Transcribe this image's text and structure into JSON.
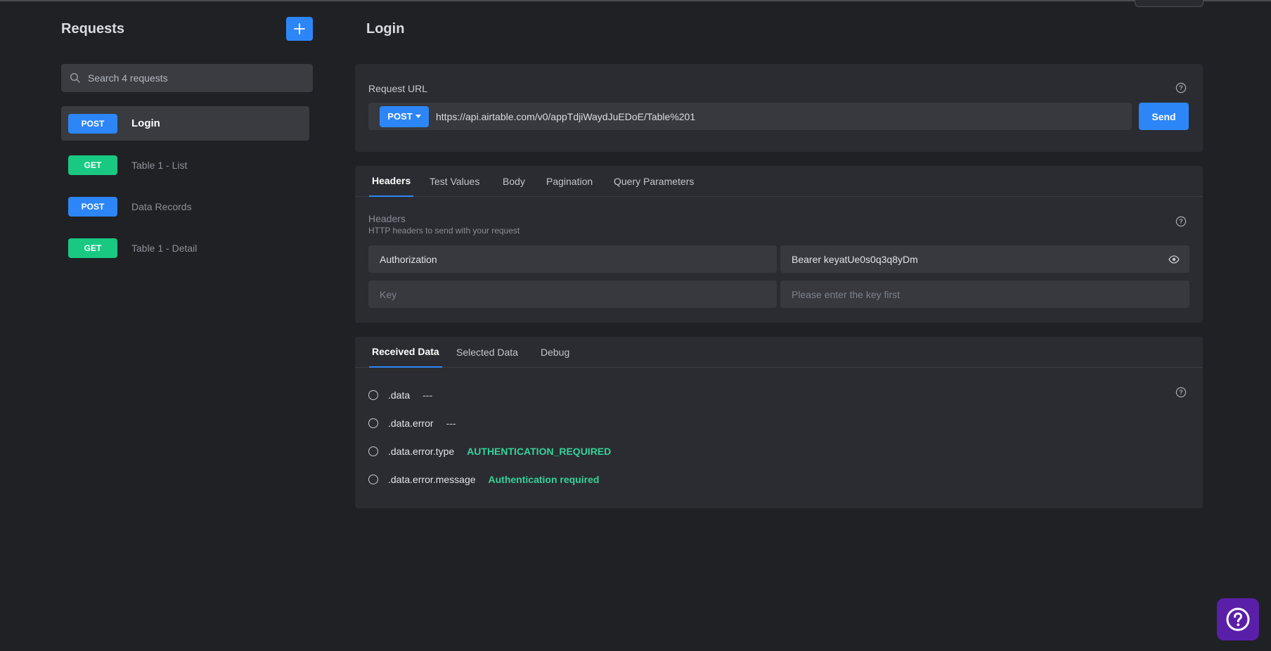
{
  "sidebar": {
    "title": "Requests",
    "search_placeholder": "Search 4 requests",
    "requests": [
      {
        "method": "POST",
        "name": "Login"
      },
      {
        "method": "GET",
        "name": "Table 1 - List"
      },
      {
        "method": "POST",
        "name": "Data Records"
      },
      {
        "method": "GET",
        "name": "Table 1 - Detail"
      }
    ]
  },
  "main": {
    "title": "Login",
    "request_url": {
      "label": "Request URL",
      "method": "POST",
      "url": "https://api.airtable.com/v0/appTdjiWaydJuEDoE/Table%201",
      "send_label": "Send"
    },
    "config_tabs": [
      "Headers",
      "Test Values",
      "Body",
      "Pagination",
      "Query Parameters"
    ],
    "headers_section": {
      "title": "Headers",
      "subtitle": "HTTP headers to send with your request",
      "rows": [
        {
          "key": "Authorization",
          "value": "Bearer keyatUe0s0q3q8yDm"
        }
      ],
      "new_row": {
        "key_placeholder": "Key",
        "value_placeholder": "Please enter the key first"
      }
    },
    "result_tabs": [
      "Received Data",
      "Selected Data",
      "Debug"
    ],
    "received_data": [
      {
        "path": ".data",
        "value": "---"
      },
      {
        "path": ".data.error",
        "value": "---"
      },
      {
        "path": ".data.error.type",
        "value": "AUTHENTICATION_REQUIRED"
      },
      {
        "path": ".data.error.message",
        "value": "Authentication required"
      }
    ]
  },
  "colors": {
    "accent": "#2d86f7",
    "get_method": "#19c982",
    "value_green": "#35d39a",
    "support_button": "#5a1fa8"
  },
  "icons": {
    "add": "plus-icon",
    "search": "search-icon",
    "help": "question-circle-icon",
    "reveal": "eye-icon",
    "support": "question-circle-icon"
  }
}
